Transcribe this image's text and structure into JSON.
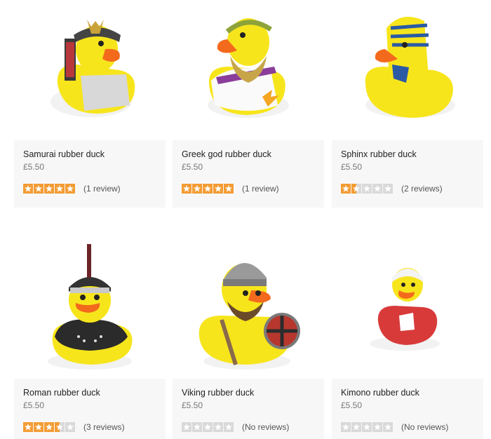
{
  "products": [
    {
      "name": "Samurai rubber duck",
      "price": "£5.50",
      "rating": 5,
      "reviews": "(1 review)",
      "image": "samurai-duck-image"
    },
    {
      "name": "Greek god rubber duck",
      "price": "£5.50",
      "rating": 5,
      "reviews": "(1 review)",
      "image": "greek-god-duck-image"
    },
    {
      "name": "Sphinx rubber duck",
      "price": "£5.50",
      "rating": 1.5,
      "reviews": "(2 reviews)",
      "image": "sphinx-duck-image"
    },
    {
      "name": "Roman rubber duck",
      "price": "£5.50",
      "rating": 3.5,
      "reviews": "(3 reviews)",
      "image": "roman-duck-image"
    },
    {
      "name": "Viking rubber duck",
      "price": "£5.50",
      "rating": 0,
      "reviews": "(No reviews)",
      "image": "viking-duck-image"
    },
    {
      "name": "Kimono rubber duck",
      "price": "£5.50",
      "rating": 0,
      "reviews": "(No reviews)",
      "image": "kimono-duck-image"
    }
  ],
  "colors": {
    "star_filled": "#f39c34",
    "star_empty": "#d9d9d9",
    "card_info_bg": "#f7f7f7"
  }
}
